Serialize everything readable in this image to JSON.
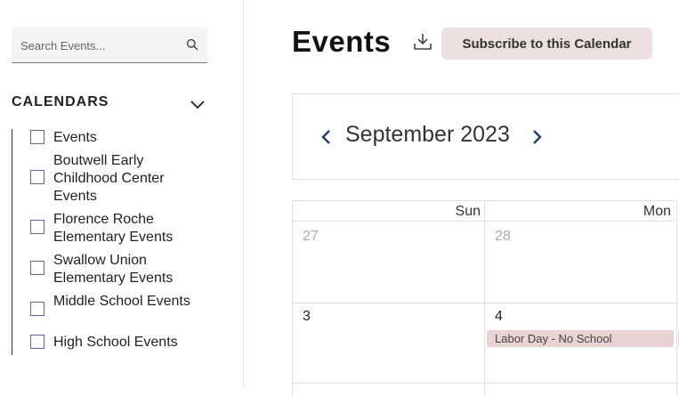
{
  "search": {
    "placeholder": "Search Events..."
  },
  "calendars": {
    "heading": "CALENDARS",
    "items": [
      {
        "label": "Events"
      },
      {
        "label": "Boutwell Early Childhood Center Events"
      },
      {
        "label": "Florence Roche Elementary Events"
      },
      {
        "label": "Swallow Union Elementary Events"
      },
      {
        "label": "Middle School Events"
      },
      {
        "label": "High School Events"
      }
    ]
  },
  "main": {
    "title": "Events",
    "subscribe_label": "Subscribe to this Calendar",
    "month_label": "September 2023",
    "day_headers": [
      "Sun",
      "Mon"
    ],
    "weeks": [
      {
        "days": [
          "27",
          "28"
        ]
      },
      {
        "days": [
          "3",
          "4"
        ]
      }
    ],
    "events": [
      {
        "label": "Labor Day - No School"
      }
    ]
  },
  "colors": {
    "accent": "#7a5aa0",
    "button_bg": "#ecdfe1",
    "event_bg": "#e8d2d4",
    "nav_arrow": "#1f3b70"
  }
}
